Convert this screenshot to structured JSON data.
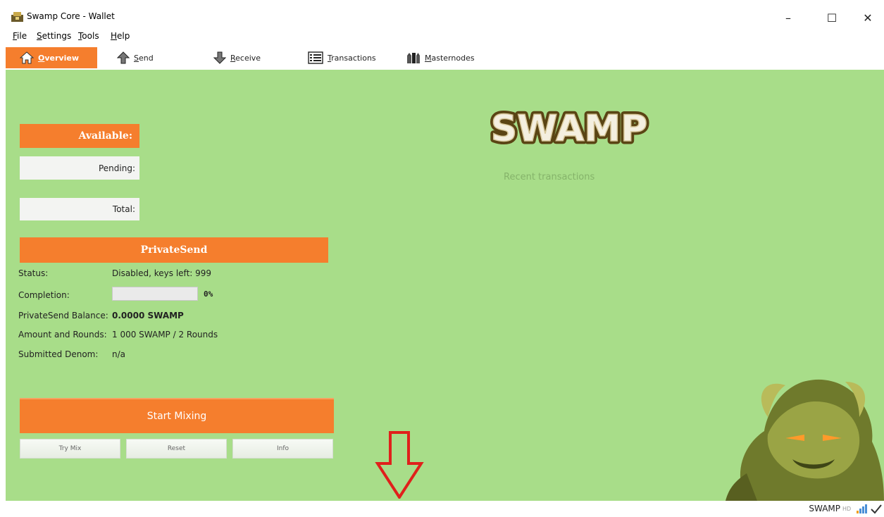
{
  "window": {
    "title": "Swamp Core - Wallet",
    "minimize": "–",
    "maximize": "☐",
    "close": "✕"
  },
  "menu": [
    {
      "underline": "F",
      "rest": "ile"
    },
    {
      "underline": "S",
      "rest": "ettings"
    },
    {
      "underline": "T",
      "rest": "ools"
    },
    {
      "underline": "H",
      "rest": "elp"
    }
  ],
  "tabs": [
    {
      "underline": "O",
      "rest": "verview",
      "icon": "home-icon",
      "active": true
    },
    {
      "underline": "S",
      "rest": "end",
      "icon": "send-arrow-up-icon",
      "active": false
    },
    {
      "underline": "R",
      "rest": "eceive",
      "icon": "receive-arrow-down-icon",
      "active": false
    },
    {
      "underline": "T",
      "rest": "ransactions",
      "icon": "transactions-list-icon",
      "active": false
    },
    {
      "underline": "M",
      "rest": "asternodes",
      "icon": "masternodes-icon",
      "active": false
    }
  ],
  "balances": {
    "available_label": "Available:",
    "pending_label": "Pending:",
    "total_label": "Total:"
  },
  "privatesend": {
    "header": "PrivateSend",
    "status_label": "Status:",
    "status_value": "Disabled, keys left: 999",
    "completion_label": "Completion:",
    "completion_percent": "0%",
    "completion_fraction": 0,
    "balance_label": "PrivateSend Balance:",
    "balance_value": "0.0000 SWAMP",
    "amount_label": "Amount and Rounds:",
    "amount_value": "1 000 SWAMP / 2 Rounds",
    "denom_label": "Submitted Denom:",
    "denom_value": "n/a",
    "start_button": "Start Mixing",
    "try_mix_button": "Try Mix",
    "reset_button": "Reset",
    "info_button": "Info"
  },
  "logo_text": "SWAMP",
  "recent_transactions": "Recent transactions",
  "statusbar": {
    "unit": "SWAMP",
    "icons": [
      "hd-wallet-icon",
      "network-bars-icon",
      "synced-check-icon"
    ]
  },
  "colors": {
    "accent": "#f57e2d",
    "background": "#a8dd89",
    "annotation_arrow": "#e0201b"
  }
}
